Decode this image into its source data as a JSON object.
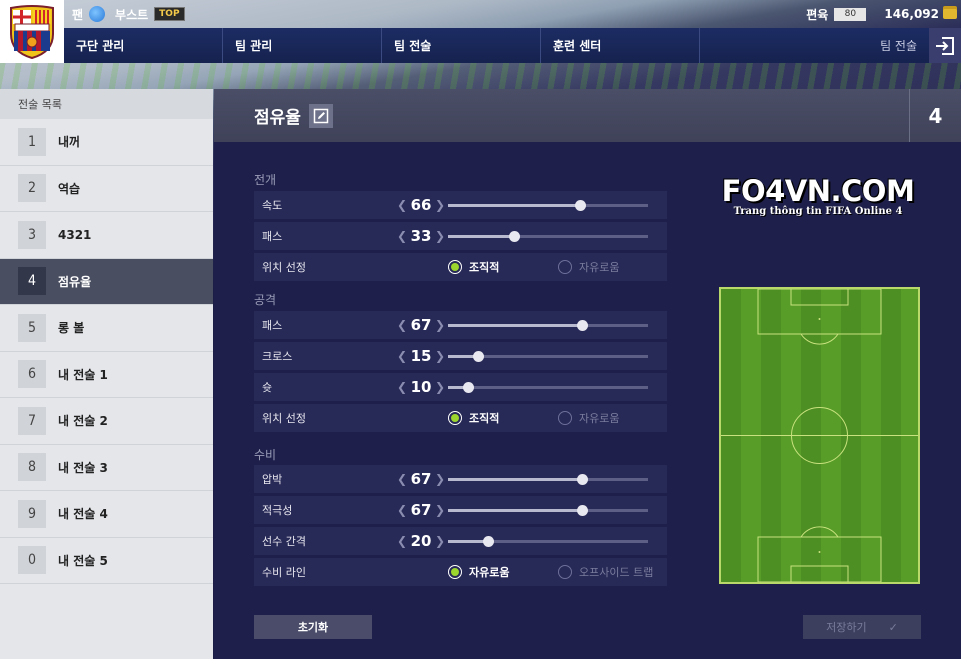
{
  "topbar": {
    "fan_label": "팬",
    "boost_label": "부스트",
    "top_badge": "TOP",
    "edit_label": "편육",
    "edit_value": "80",
    "coins": "146,092"
  },
  "nav": {
    "items": [
      "구단 관리",
      "팀 관리",
      "팀 전술",
      "훈련 센터"
    ],
    "current": "팀 전술"
  },
  "sidebar": {
    "header": "전술 목록",
    "items": [
      {
        "num": "1",
        "name": "내꺼"
      },
      {
        "num": "2",
        "name": "역습"
      },
      {
        "num": "3",
        "name": "4321"
      },
      {
        "num": "4",
        "name": "점유율"
      },
      {
        "num": "5",
        "name": "롱 볼"
      },
      {
        "num": "6",
        "name": "내 전술 1"
      },
      {
        "num": "7",
        "name": "내 전술 2"
      },
      {
        "num": "8",
        "name": "내 전술 3"
      },
      {
        "num": "9",
        "name": "내 전술 4"
      },
      {
        "num": "0",
        "name": "내 전술 5"
      }
    ],
    "active_index": 3
  },
  "tactic": {
    "title": "점유율",
    "number": "4"
  },
  "sections": {
    "buildup": {
      "label": "전개",
      "speed": {
        "label": "속도",
        "value": 66,
        "display": "66"
      },
      "passing": {
        "label": "패스",
        "value": 33,
        "display": "33"
      },
      "positioning": {
        "label": "위치 선정",
        "option_a": "조직적",
        "option_b": "자유로움",
        "selected": "option_a"
      }
    },
    "attack": {
      "label": "공격",
      "passing": {
        "label": "패스",
        "value": 67,
        "display": "67"
      },
      "crossing": {
        "label": "크로스",
        "value": 15,
        "display": "15"
      },
      "shooting": {
        "label": "슛",
        "value": 10,
        "display": "10"
      },
      "positioning": {
        "label": "위치 선정",
        "option_a": "조직적",
        "option_b": "자유로움",
        "selected": "option_a"
      }
    },
    "defense": {
      "label": "수비",
      "pressure": {
        "label": "압박",
        "value": 67,
        "display": "67"
      },
      "aggression": {
        "label": "적극성",
        "value": 67,
        "display": "67"
      },
      "width": {
        "label": "선수 간격",
        "value": 20,
        "display": "20"
      },
      "line": {
        "label": "수비 라인",
        "option_a": "자유로움",
        "option_b": "오프사이드 트랩",
        "selected": "option_a"
      }
    }
  },
  "buttons": {
    "reset": "초기화",
    "save": "저장하기"
  },
  "watermark": {
    "big": "FO4VN.COM",
    "small": "Trang thông tin FIFA Online 4"
  },
  "colors": {
    "accent_green": "#9cd52e",
    "navy": "#1e1f4a",
    "active_row": "#4a4e61"
  }
}
